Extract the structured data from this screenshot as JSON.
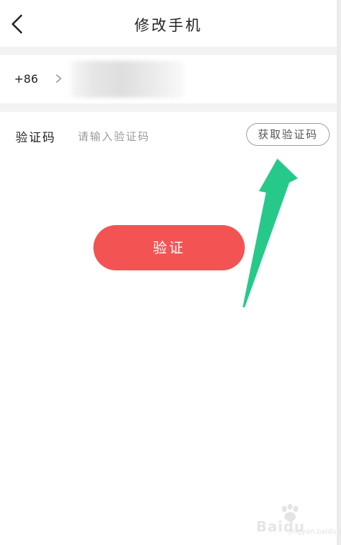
{
  "header": {
    "title": "修改手机",
    "back_icon": "chevron-left-icon"
  },
  "phone": {
    "country_code": "+86",
    "chevron_icon": "chevron-right-icon"
  },
  "verification": {
    "label": "验证码",
    "placeholder": "请输入验证码",
    "get_code_label": "获取验证码"
  },
  "actions": {
    "verify_label": "验证"
  },
  "annotation": {
    "arrow_color": "#27c98a"
  },
  "watermark": {
    "brand": "Baidu",
    "sub": "jingyan.baidu.com"
  },
  "colors": {
    "primary_button": "#f45353",
    "background": "#ffffff",
    "divider": "#f3f3f3"
  }
}
